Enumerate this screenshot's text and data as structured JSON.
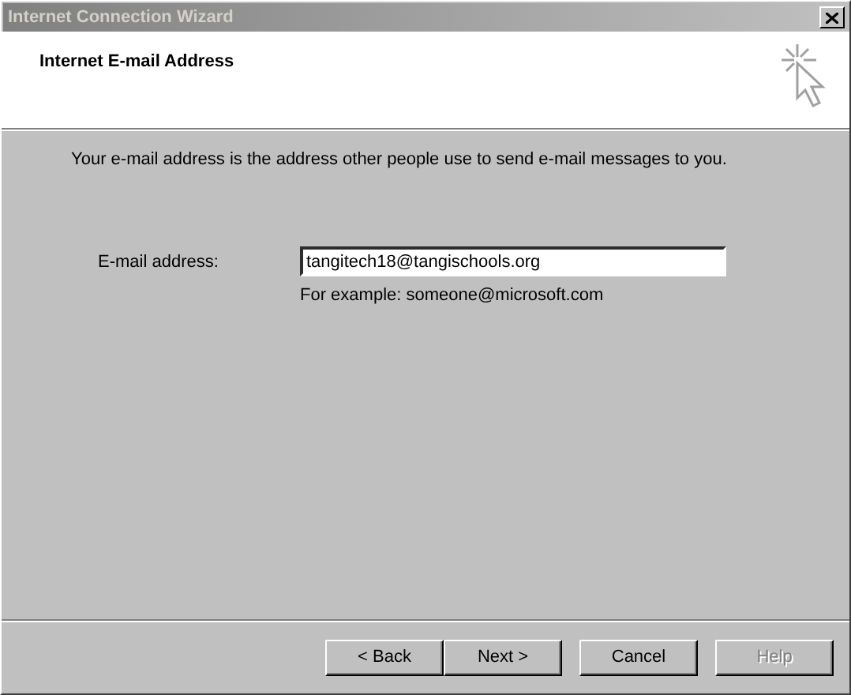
{
  "window": {
    "title": "Internet Connection Wizard",
    "active": false
  },
  "header": {
    "title": "Internet E-mail Address"
  },
  "intro": "Your e-mail address is the address other people use to send e-mail messages to you.",
  "field": {
    "label": "E-mail address:",
    "value": "tangitech18@tangischools.org",
    "hint": "For example: someone@microsoft.com"
  },
  "buttons": [
    {
      "label": "< Back",
      "disabled": false,
      "kind": "paired"
    },
    {
      "label": "Next >",
      "disabled": false,
      "kind": "paired"
    },
    {
      "label": "Cancel",
      "disabled": false,
      "kind": "single"
    },
    {
      "label": "Help",
      "disabled": true,
      "kind": "single"
    }
  ]
}
